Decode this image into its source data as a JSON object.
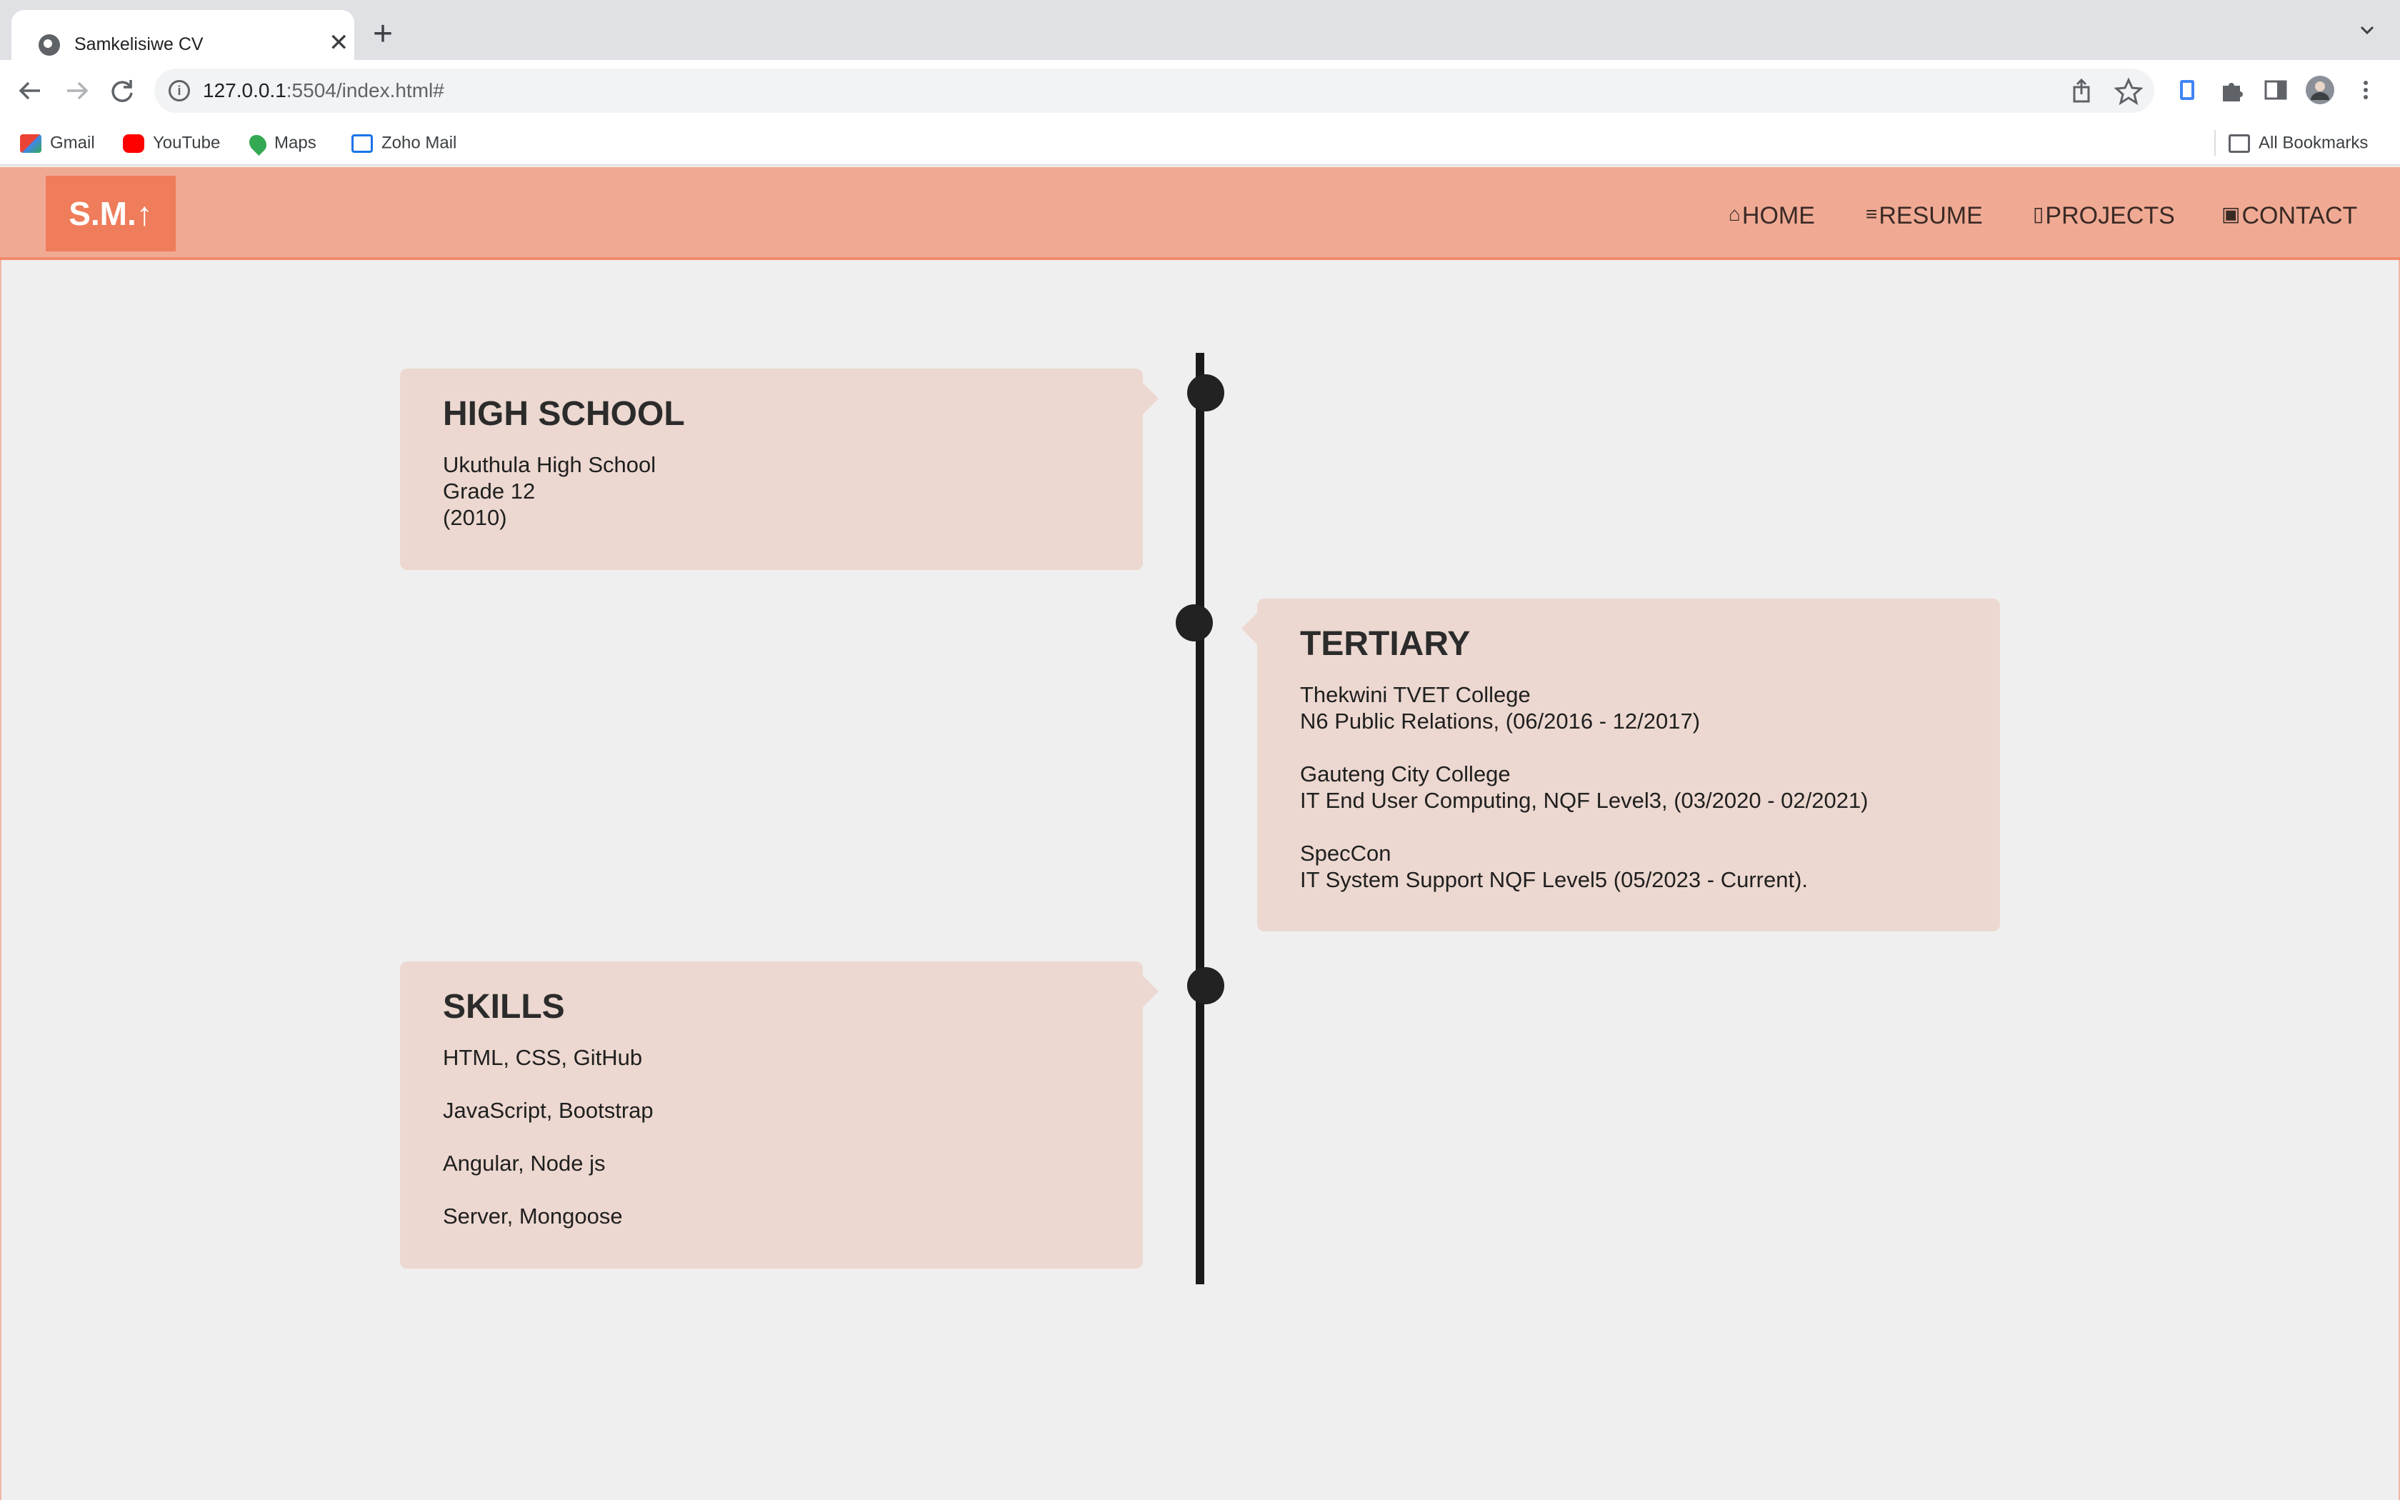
{
  "browser": {
    "tab_title": "Samkelisiwe CV",
    "tab_close": "✕",
    "new_tab": "+",
    "url_host": "127.0.0.1",
    "url_rest": ":5504/index.html#",
    "icons": {
      "back": "back-arrow-icon",
      "forward": "forward-arrow-icon",
      "reload": "reload-icon",
      "info": "site-info-icon",
      "share": "share-icon",
      "star": "bookmark-star-icon",
      "extensions": "puzzle-icon",
      "side_panel": "side-panel-icon",
      "menu": "kebab-menu-icon"
    },
    "bookmarks": [
      {
        "label": "Gmail",
        "color": "#ea4335"
      },
      {
        "label": "YouTube",
        "color": "#ff0000"
      },
      {
        "label": "Maps",
        "color": "#34a853"
      },
      {
        "label": "Zoho Mail",
        "color": "#1a73e8"
      }
    ],
    "all_bookmarks": "All Bookmarks"
  },
  "site": {
    "logo": "S.M.↑",
    "nav": [
      {
        "glyph": "⌂",
        "label": "HOME"
      },
      {
        "glyph": "≡",
        "label": "RESUME"
      },
      {
        "glyph": "▯",
        "label": "PROJECTS"
      },
      {
        "glyph": "▣",
        "label": "CONTACT"
      }
    ],
    "colors": {
      "header": "#f0aa94",
      "logo": "#ef7c5a",
      "card": "#ecd8d0",
      "timeline": "#1a1a1a"
    }
  },
  "timeline": {
    "high_school": {
      "title": "HIGH SCHOOL",
      "lines": [
        "Ukuthula High School",
        "Grade 12",
        "(2010)"
      ]
    },
    "tertiary": {
      "title": "TERTIARY",
      "entries": [
        {
          "name": "Thekwini TVET College",
          "detail": "N6 Public Relations, (06/2016 - 12/2017)"
        },
        {
          "name": "Gauteng City College",
          "detail": "IT End User Computing, NQF Level3, (03/2020 - 02/2021)"
        },
        {
          "name": "SpecCon",
          "detail": "IT System Support NQF Level5 (05/2023 - Current)."
        }
      ]
    },
    "skills": {
      "title": "SKILLS",
      "items": [
        "HTML, CSS, GitHub",
        "JavaScript, Bootstrap",
        "Angular, Node js",
        "Server, Mongoose"
      ]
    }
  }
}
